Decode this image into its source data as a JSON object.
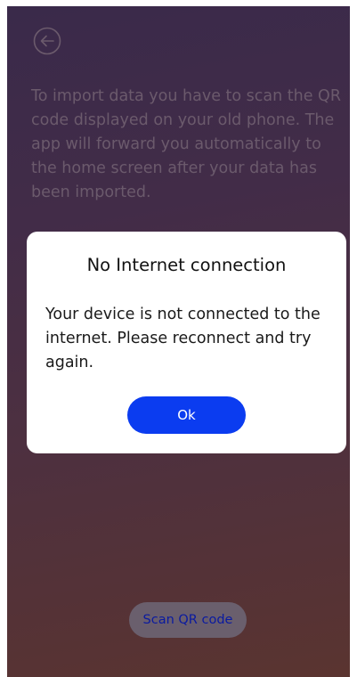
{
  "instructions": {
    "text": "To import data you have to scan the QR code displayed on your old phone. The app will forward you automatically to the home screen after your data has been imported."
  },
  "icons": {
    "back": "back-arrow-circle-icon"
  },
  "dialog": {
    "title": "No Internet connection",
    "message": "Your device is not connected to the internet. Please reconnect and try again.",
    "ok_label": "Ok"
  },
  "footer": {
    "scan_label": "Scan QR code"
  },
  "colors": {
    "accent": "#0b3cf0",
    "scan_button_bg": "#6a5f6d",
    "scan_button_text": "#0a1aa0",
    "dialog_bg": "#ffffff"
  }
}
